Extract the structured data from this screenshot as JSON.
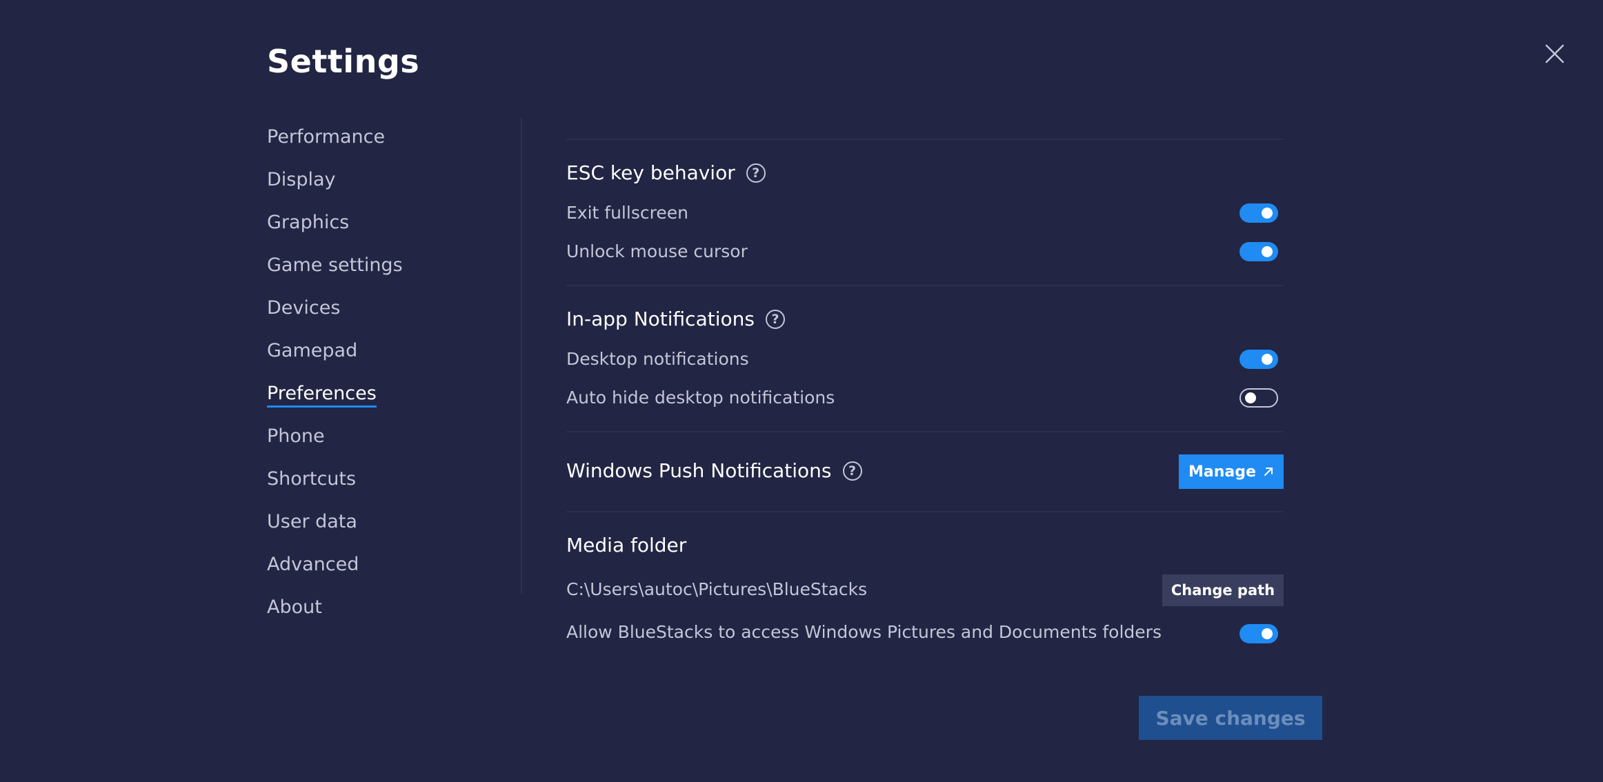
{
  "header": {
    "title": "Settings"
  },
  "sidebar": {
    "items": [
      {
        "label": "Performance",
        "active": false
      },
      {
        "label": "Display",
        "active": false
      },
      {
        "label": "Graphics",
        "active": false
      },
      {
        "label": "Game settings",
        "active": false
      },
      {
        "label": "Devices",
        "active": false
      },
      {
        "label": "Gamepad",
        "active": false
      },
      {
        "label": "Preferences",
        "active": true
      },
      {
        "label": "Phone",
        "active": false
      },
      {
        "label": "Shortcuts",
        "active": false
      },
      {
        "label": "User data",
        "active": false
      },
      {
        "label": "Advanced",
        "active": false
      },
      {
        "label": "About",
        "active": false
      }
    ]
  },
  "esc": {
    "title": "ESC key behavior",
    "exit_fullscreen": {
      "label": "Exit fullscreen",
      "on": true
    },
    "unlock_cursor": {
      "label": "Unlock mouse cursor",
      "on": true
    }
  },
  "notifications": {
    "title": "In-app Notifications",
    "desktop": {
      "label": "Desktop notifications",
      "on": true
    },
    "auto_hide": {
      "label": "Auto hide desktop notifications",
      "on": false
    }
  },
  "push": {
    "title": "Windows Push Notifications",
    "manage_label": "Manage"
  },
  "media": {
    "title": "Media folder",
    "path": "C:\\Users\\autoc\\Pictures\\BlueStacks",
    "change_path_label": "Change path",
    "allow_access": {
      "label": "Allow BlueStacks to access Windows Pictures and Documents folders",
      "on": true
    }
  },
  "footer": {
    "save_label": "Save changes"
  },
  "colors": {
    "background": "#222543",
    "accent": "#1f8bf3",
    "text_secondary": "#c4c6d8",
    "save_disabled": "#1f4f8f"
  },
  "icons": {
    "close": "close-icon",
    "help": "question-circle-icon",
    "external": "arrow-up-right-icon"
  }
}
